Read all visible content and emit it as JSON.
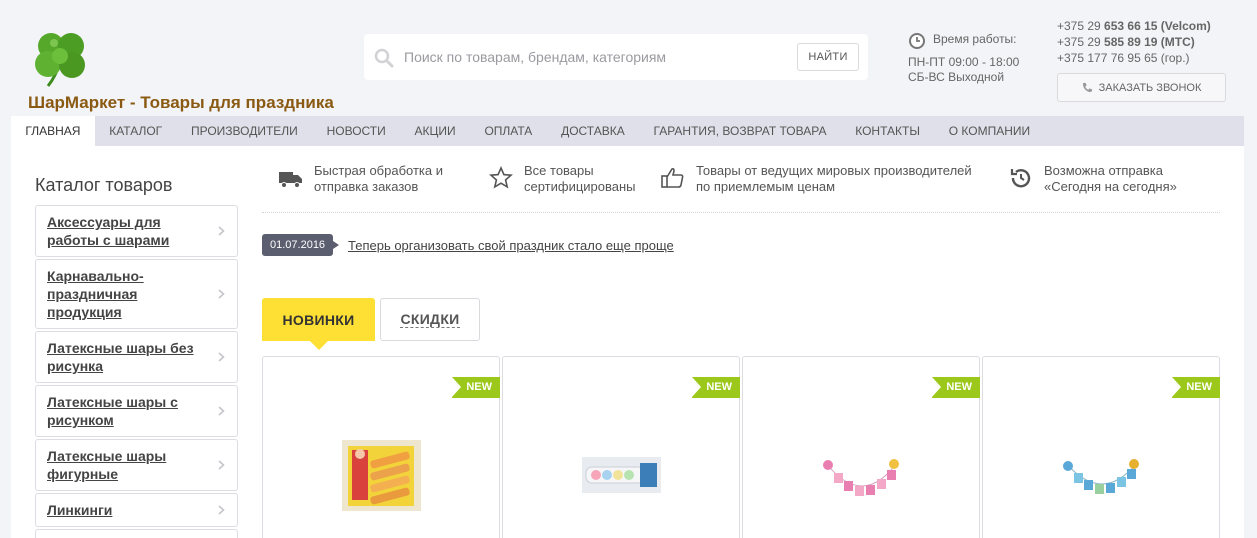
{
  "header": {
    "site_title": "ШарМаркет - Товары для праздника",
    "search_placeholder": "Поиск по товарам, брендам, категориям",
    "search_button": "НАЙТИ",
    "hours_title": "Время работы:",
    "hours_weekdays": "ПН-ПТ 09:00 - 18:00",
    "hours_weekend": "СБ-ВС Выходной",
    "phones": [
      {
        "prefix": "+375 29 ",
        "number": "653 66 15",
        "operator": " (Velcom)"
      },
      {
        "prefix": "+375 29 ",
        "number": "585 89 19",
        "operator": " (МТС)"
      },
      {
        "prefix": "+375 177 76 95 65 (гор.)",
        "number": "",
        "operator": ""
      }
    ],
    "callback_label": "ЗАКАЗАТЬ ЗВОНОК"
  },
  "nav": {
    "items": [
      "ГЛАВНАЯ",
      "КАТАЛОГ",
      "ПРОИЗВОДИТЕЛИ",
      "НОВОСТИ",
      "АКЦИИ",
      "ОПЛАТА",
      "ДОСТАВКА",
      "ГАРАНТИЯ, ВОЗВРАТ ТОВАРА",
      "КОНТАКТЫ",
      "О КОМПАНИИ"
    ],
    "active": "ГЛАВНАЯ"
  },
  "catalog": {
    "title": "Каталог товаров",
    "items": [
      "Аксессуары для работы с шарами",
      "Карнавально-праздничная продукция",
      "Латексные шары без рисунка",
      "Латексные шары с рисунком",
      "Латексные шары фигурные",
      "Линкинги"
    ]
  },
  "features": [
    {
      "icon": "truck-icon",
      "line1": "Быстрая обработка и",
      "line2": "отправка заказов"
    },
    {
      "icon": "star-icon",
      "line1": "Все товары",
      "line2": "сертифицированы"
    },
    {
      "icon": "thumbs-up-icon",
      "line1": "Товары от ведущих мировых производителей",
      "line2": "по приемлемым ценам"
    },
    {
      "icon": "history-icon",
      "line1": "Возможна отправка",
      "line2": "«Сегодня на сегодня»"
    }
  ],
  "news": {
    "date": "01.07.2016",
    "title": "Теперь организовать свой праздник стало еще проще"
  },
  "tabs": {
    "new": "НОВИНКИ",
    "sale": "СКИДКИ"
  },
  "products": [
    {
      "badge": "NEW"
    },
    {
      "badge": "NEW"
    },
    {
      "badge": "NEW"
    },
    {
      "badge": "NEW"
    }
  ],
  "colors": {
    "accent_yellow": "#fde033",
    "badge_green": "#9bc81a",
    "title_brown": "#8a5a12",
    "nav_bg": "#dfe0e9"
  }
}
